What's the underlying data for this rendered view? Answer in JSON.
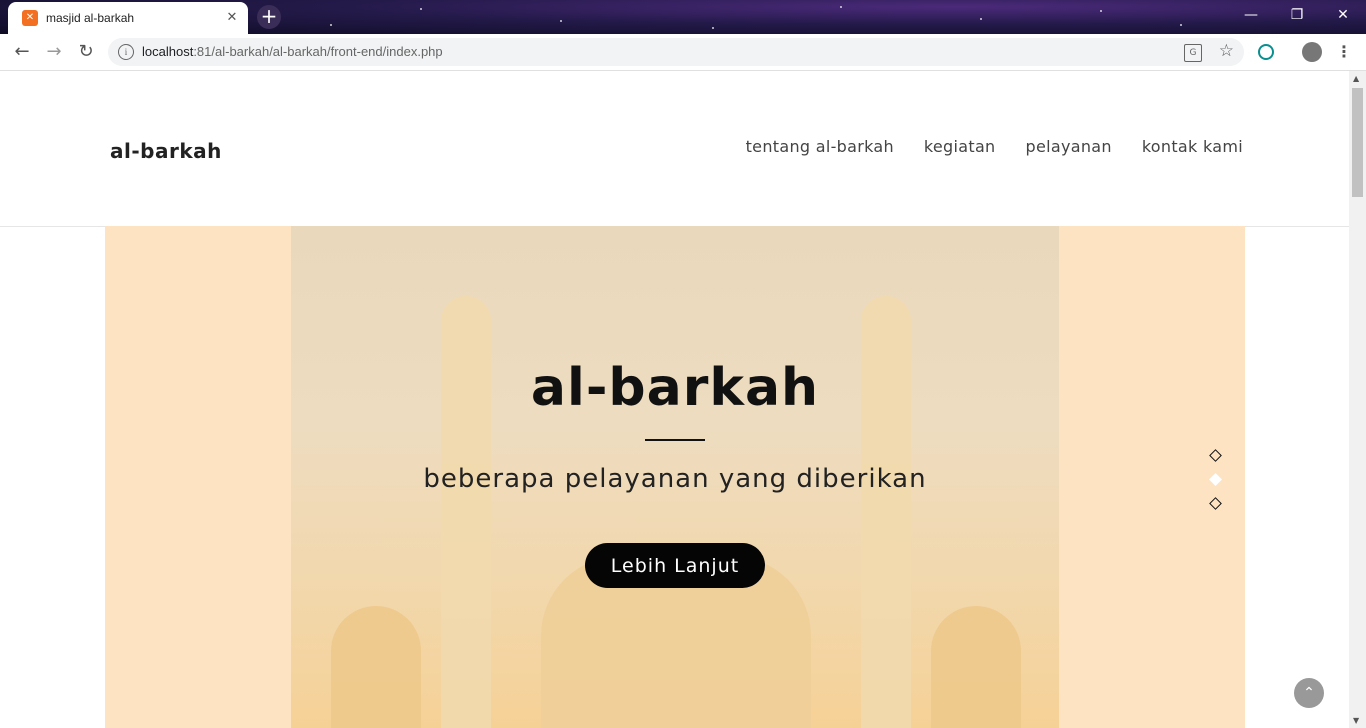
{
  "browser": {
    "tab_title": "masjid al-barkah",
    "tab_favicon": "xampp-icon",
    "url_host": "localhost",
    "url_rest": ":81/al-barkah/al-barkah/front-end/index.php",
    "window_controls": [
      "minimize-icon",
      "restore-icon",
      "close-icon"
    ]
  },
  "header": {
    "logo": "al-barkah",
    "nav": [
      "tentang al-barkah",
      "kegiatan",
      "pelayanan",
      "kontak kami"
    ]
  },
  "hero": {
    "title": "al-barkah",
    "subtitle": "beberapa pelayanan yang diberikan",
    "button": "Lebih Lanjut",
    "slide_count": 3,
    "active_slide": 2,
    "background_color": "#fde3c2"
  }
}
